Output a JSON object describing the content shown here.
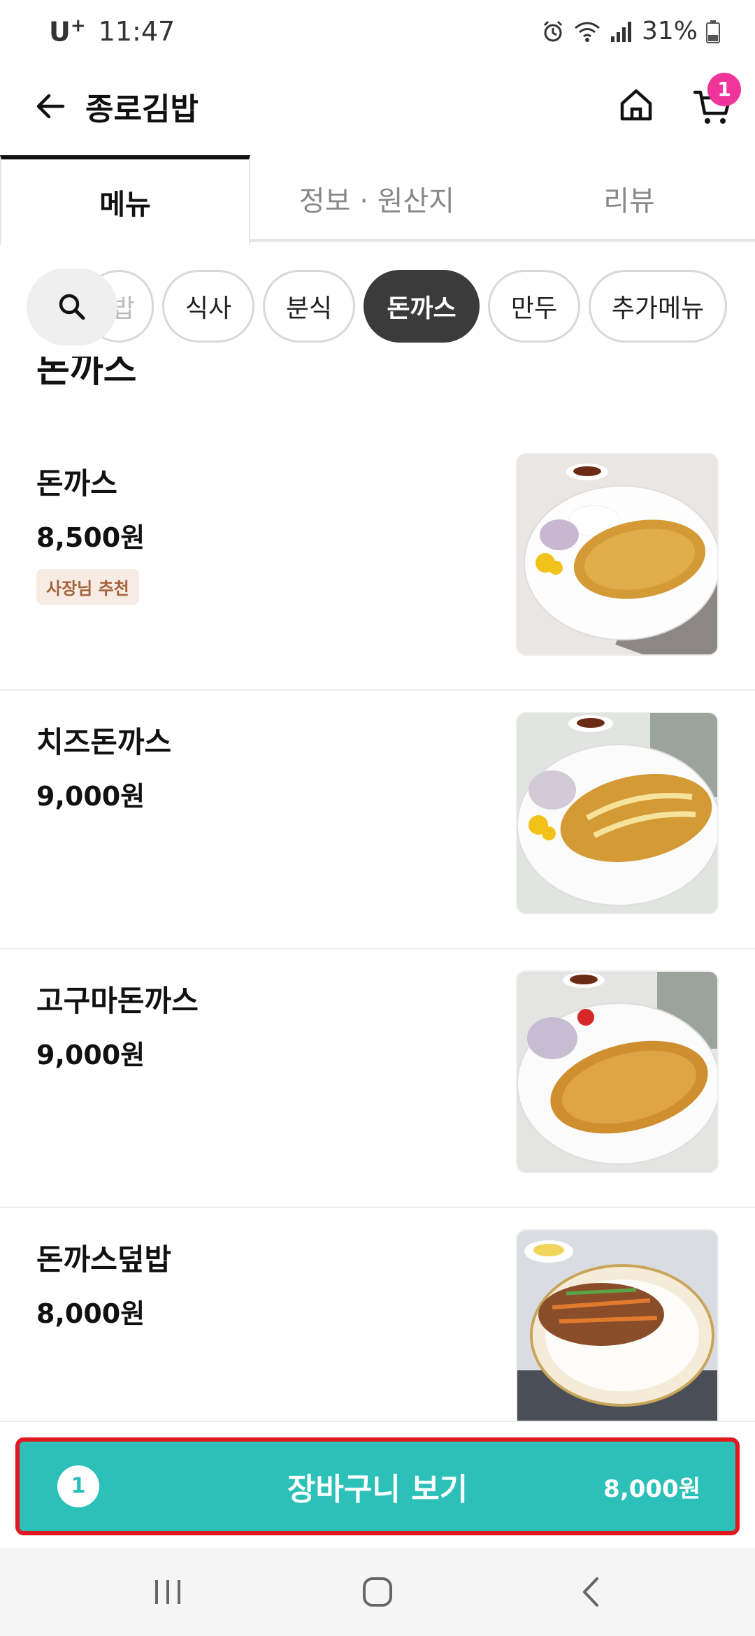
{
  "status_bar": {
    "carrier": "U",
    "carrier_sup": "+",
    "time": "11:47",
    "battery": "31%"
  },
  "header": {
    "title": "종로김밥",
    "cart_badge": "1"
  },
  "tabs": [
    {
      "label": "메뉴",
      "active": true
    },
    {
      "label": "정보 · 원산지",
      "active": false
    },
    {
      "label": "리뷰",
      "active": false
    }
  ],
  "categories": [
    {
      "label": "밥",
      "active": false
    },
    {
      "label": "식사",
      "active": false
    },
    {
      "label": "분식",
      "active": false
    },
    {
      "label": "돈까스",
      "active": true
    },
    {
      "label": "만두",
      "active": false
    },
    {
      "label": "추가메뉴",
      "active": false
    }
  ],
  "section": {
    "title": "돈까스"
  },
  "menu_items": [
    {
      "name": "돈까스",
      "price": "8,500원",
      "tag": "사장님 추천"
    },
    {
      "name": "치즈돈까스",
      "price": "9,000원"
    },
    {
      "name": "고구마돈까스",
      "price": "9,000원"
    },
    {
      "name": "돈까스덮밥",
      "price": "8,000원"
    }
  ],
  "cart_bar": {
    "count": "1",
    "label": "장바구니 보기",
    "total": "8,000원"
  },
  "colors": {
    "accent": "#2cc0b9",
    "badge": "#f0359a",
    "highlight_border": "#e0181f",
    "chip_active": "#3b3b3b"
  },
  "icons": {
    "back": "arrow-left-icon",
    "home": "home-icon",
    "cart": "cart-icon",
    "search": "search-icon"
  }
}
